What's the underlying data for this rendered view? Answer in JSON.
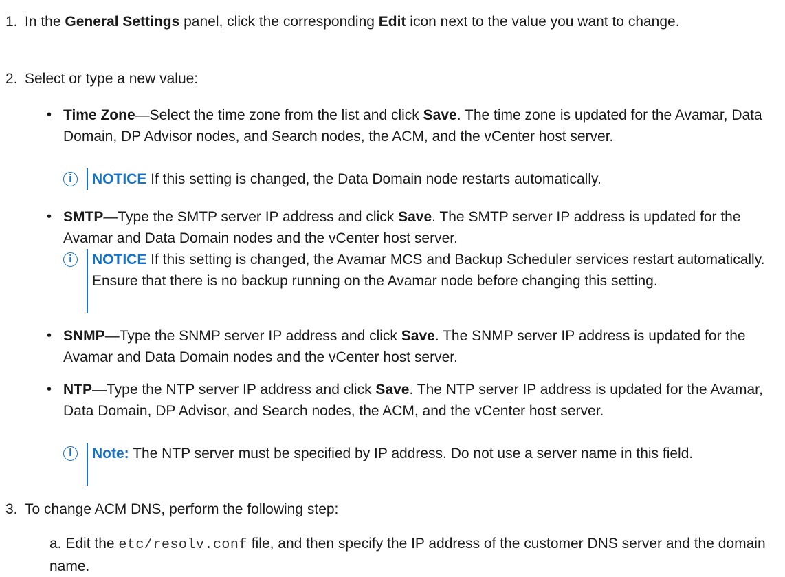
{
  "steps": [
    {
      "number": "1.",
      "parts": [
        "In the ",
        "General Settings",
        " panel, click the corresponding ",
        "Edit",
        " icon next to the value you want to change."
      ]
    },
    {
      "number": "2.",
      "text": "Select or type a new value:"
    },
    {
      "number": "3.",
      "text": "To change ACM DNS, perform the following step:"
    }
  ],
  "bullets": [
    {
      "term": "Time Zone",
      "dash": "—",
      "pre": "Select the time zone from the list and click ",
      "save": "Save",
      "post": ". The time zone is updated for the Avamar, Data Domain, DP Advisor nodes, and Search nodes, the ACM, and the vCenter host server.",
      "notice_tag": "NOTICE",
      "notice_text": " If this setting is changed, the Data Domain node restarts automatically."
    },
    {
      "term": "SMTP",
      "dash": "—",
      "pre": "Type the SMTP server IP address and click ",
      "save": "Save",
      "post": ". The SMTP server IP address is updated for the Avamar and Data Domain nodes and the vCenter host server.",
      "notice_tag": "NOTICE",
      "notice_text": " If this setting is changed, the Avamar MCS and Backup Scheduler services restart automatically. Ensure that there is no backup running on the Avamar node before changing this setting."
    },
    {
      "term": "SNMP",
      "dash": "—",
      "pre": "Type the SNMP server IP address and click ",
      "save": "Save",
      "post": ". The SNMP server IP address is updated for the Avamar and Data Domain nodes and the vCenter host server."
    },
    {
      "term": "NTP",
      "dash": "—",
      "pre": "Type the NTP server IP address and click ",
      "save": "Save",
      "post": ". The NTP server IP address is updated for the Avamar, Data Domain, DP Advisor, and Search nodes, the ACM, and the vCenter host server.",
      "notice_tag": "Note:",
      "notice_text": " The NTP server must be specified by IP address. Do not use a server name in this field."
    }
  ],
  "substep": {
    "letter": "a.",
    "pre": " Edit the ",
    "code": "etc/resolv.conf",
    "post": " file, and then specify the IP address of the customer DNS server and the domain name."
  },
  "icons": {
    "info": "info-circle-icon",
    "accent_color": "#1572c7"
  }
}
